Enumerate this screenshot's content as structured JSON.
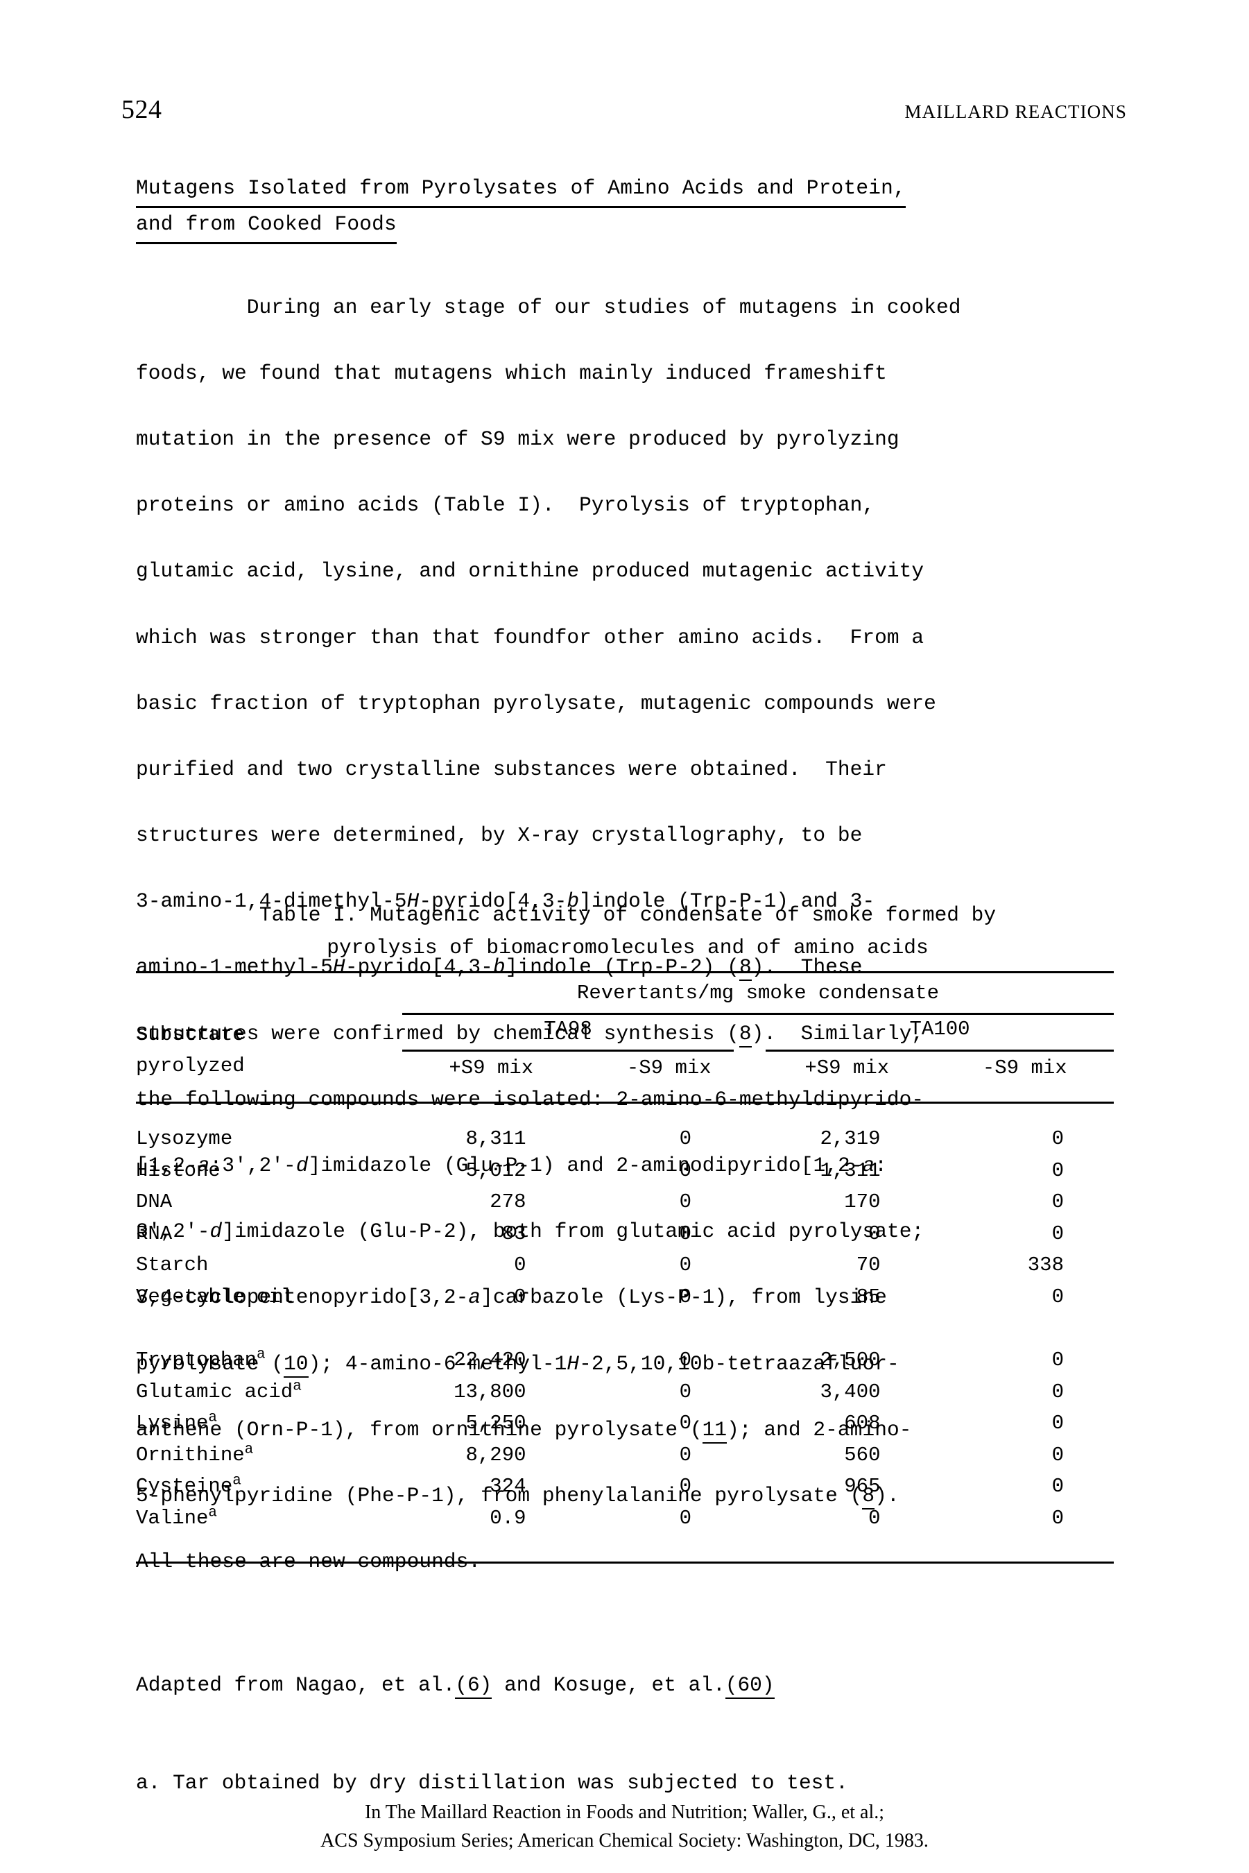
{
  "running_head": {
    "folio": "524",
    "title": "MAILLARD REACTIONS"
  },
  "heading": {
    "line1": "Mutagens Isolated from Pyrolysates of Amino Acids and Protein,",
    "line2": "and from Cooked Foods"
  },
  "paragraph": {
    "text": "     During an early stage of our studies of mutagens in cooked foods, we found that mutagens which mainly induced frameshift mutation in the presence of S9 mix were produced by pyrolyzing proteins or amino acids (Table I).  Pyrolysis of tryptophan, glutamic acid, lysine, and ornithine produced mutagenic activity which was stronger than that foundfor other amino acids.  From a basic fraction of tryptophan pyrolysate, mutagenic compounds were purified and two crystalline substances were obtained.  Their structures were determined, by X-ray crystallography, to be 3-amino-1,4-dimethyl-5H-pyrido[4,3-b]indole (Trp-P-1) and 3-amino-1-methyl-5H-pyrido[4,3-b]indole (Trp-P-2) (8).  These structures were confirmed by chemical synthesis (8).  Similarly, the following compounds were isolated: 2-amino-6-methyldipyrido-[1,2-a:3',2'-d]imidazole (Glu-P-1) and 2-aminodipyrido[1,2-a:3',2'-d]imidazole (Glu-P-2), both from glutamic acid pyrolysate; 3,4-cyclopentenopyrido[3,2-a]carbazole (Lys-P-1), from lysine pyrolysate (10); 4-amino-6-methyl-1H-2,5,10,10b-tetraazafluoranthene (Orn-P-1), from ornithine pyrolysate (11); and 2-amino-5-phenylpyridine (Phe-P-1), from phenylalanine pyrolysate (8).  All these are new compounds.",
    "lines": [
      "     During an early stage of our studies of mutagens in cooked",
      "foods, we found that mutagens which mainly induced frameshift",
      "mutation in the presence of S9 mix were produced by pyrolyzing",
      "proteins or amino acids (Table I).  Pyrolysis of tryptophan,",
      "glutamic acid, lysine, and ornithine produced mutagenic activity",
      "which was stronger than that foundfor other amino acids.  From a",
      "basic fraction of tryptophan pyrolysate, mutagenic compounds were",
      "purified and two crystalline substances were obtained.  Their",
      "structures were determined, by X-ray crystallography, to be",
      "3-amino-1,4-dimethyl-5H-pyrido[4,3-b]indole (Trp-P-1) and 3-",
      "amino-1-methyl-5H-pyrido[4,3-b]indole (Trp-P-2) (8).  These",
      "structures were confirmed by chemical synthesis (8).  Similarly,",
      "the following compounds were isolated: 2-amino-6-methyldipyrido-",
      "[1,2-a:3',2'-d]imidazole (Glu-P-1) and 2-aminodipyrido[1,2-a:",
      "3',2'-d]imidazole (Glu-P-2), both from glutamic acid pyrolysate;",
      "3,4-cyclopentenopyrido[3,2-a]carbazole (Lys-P-1), from lysine",
      "pyrolysate (10); 4-amino-6-methyl-1H-2,5,10,10b-tetraazafluor-",
      "anthene (Orn-P-1), from ornithine pyrolysate (11); and 2-amino-",
      "5-phenylpyridine (Phe-P-1), from phenylalanine pyrolysate (8).",
      "All these are new compounds."
    ]
  },
  "table": {
    "caption_line1": "Table I.  Mutagenic activity of condensate of smoke formed by",
    "caption_line2": "pyrolysis of biomacromolecules and of amino acids",
    "substrate_label_line1": "Substrate",
    "substrate_label_line2": "pyrolyzed",
    "span_header": "Revertants/mg smoke condensate",
    "strains": [
      "TA98",
      "TA100"
    ],
    "mix_headers": [
      "+S9 mix",
      "-S9 mix",
      "+S9 mix",
      "-S9 mix"
    ],
    "footnote_marker": "a",
    "group1": [
      {
        "substrate": "Lysozyme",
        "footnote": false,
        "values": [
          "8,311",
          "0",
          "2,319",
          "0"
        ]
      },
      {
        "substrate": "Histone",
        "footnote": false,
        "values": [
          "5,012",
          "0",
          "1,311",
          "0"
        ]
      },
      {
        "substrate": "DNA",
        "footnote": false,
        "values": [
          "278",
          "0",
          "170",
          "0"
        ]
      },
      {
        "substrate": "RNA",
        "footnote": false,
        "values": [
          "83",
          "0",
          "0",
          "0"
        ]
      },
      {
        "substrate": "Starch",
        "footnote": false,
        "values": [
          "0",
          "0",
          "70",
          "338"
        ]
      },
      {
        "substrate": "Vegetable oil",
        "footnote": false,
        "values": [
          "0",
          "0",
          "85",
          "0"
        ]
      }
    ],
    "group2": [
      {
        "substrate": "Tryptophan",
        "footnote": true,
        "values": [
          "22,420",
          "0",
          "2,500",
          "0"
        ]
      },
      {
        "substrate": "Glutamic acid",
        "footnote": true,
        "values": [
          "13,800",
          "0",
          "3,400",
          "0"
        ]
      },
      {
        "substrate": "Lysine",
        "footnote": true,
        "values": [
          "5,250",
          "0",
          "608",
          "0"
        ]
      },
      {
        "substrate": "Ornithine",
        "footnote": true,
        "values": [
          "8,290",
          "0",
          "560",
          "0"
        ]
      },
      {
        "substrate": "Cysteine",
        "footnote": true,
        "values": [
          "324",
          "0",
          "965",
          "0"
        ]
      },
      {
        "substrate": "Valine",
        "footnote": true,
        "values": [
          "0.9",
          "0",
          "0",
          "0"
        ]
      }
    ]
  },
  "footnotes": {
    "source_pre": "Adapted from Nagao, et al.",
    "source_ref1": "(6)",
    "source_mid": " and Kosuge, et al.",
    "source_ref2": "(60)",
    "note_a": "a. Tar obtained by dry distillation was subjected to test."
  },
  "page_footer": {
    "line1": "In The Maillard Reaction in Foods and Nutrition; Waller, G., et al.;",
    "line2": "ACS Symposium Series; American Chemical Society: Washington, DC, 1983."
  }
}
